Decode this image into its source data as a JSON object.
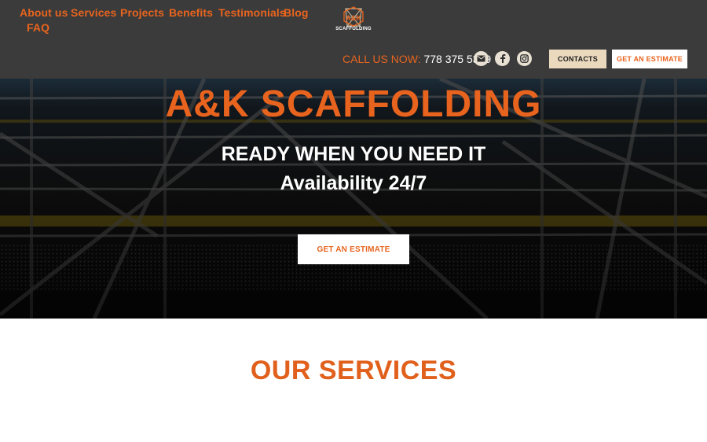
{
  "nav": {
    "items": [
      {
        "label": "About us"
      },
      {
        "label": "Services"
      },
      {
        "label": "Projects"
      },
      {
        "label": "Benefits"
      },
      {
        "label": "Testimonials"
      },
      {
        "label": "Blog"
      },
      {
        "label": "FAQ"
      }
    ]
  },
  "logo": {
    "text": "SCAFFOLDING",
    "icon": "scaffold-logo-icon"
  },
  "contact": {
    "call_label": "CALL US NOW:",
    "phone": "778 375 5349"
  },
  "social": [
    {
      "icon": "mail-icon"
    },
    {
      "icon": "facebook-icon"
    },
    {
      "icon": "instagram-icon"
    }
  ],
  "header_buttons": {
    "contacts": "CONTACTS",
    "estimate": "GET AN ESTIMATE"
  },
  "hero": {
    "title": "A&K SCAFFOLDING",
    "subtitle1": "READY WHEN YOU NEED IT",
    "subtitle2": "Availability 24/7",
    "cta": "GET AN ESTIMATE"
  },
  "services": {
    "title": "OUR SERVICES"
  },
  "colors": {
    "accent": "#e8641e",
    "header_bg": "#3b3b3b",
    "contacts_bg": "#ead9bd"
  }
}
